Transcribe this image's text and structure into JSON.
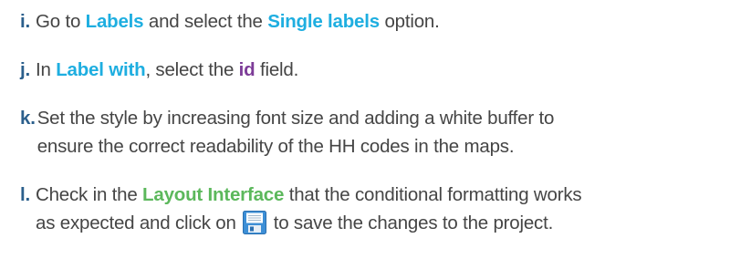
{
  "steps": [
    {
      "letter": "i.",
      "t1": "Go to ",
      "k1": "Labels",
      "t2": " and select the ",
      "k2": "Single labels",
      "t3": " option."
    },
    {
      "letter": "j.",
      "t1": "In ",
      "k1": "Label with",
      "t2": ", select the ",
      "k2": "id",
      "t3": " field."
    },
    {
      "letter": "k.",
      "line1": "Set the style by increasing font size and adding a white buffer to",
      "line2": "ensure the correct readability of the HH codes in the maps."
    },
    {
      "letter": "l.",
      "t1": "Check in the ",
      "k1": "Layout Interface",
      "t2": " that the conditional formatting works",
      "t3": "as expected and click on ",
      "icon": "save-floppy-icon",
      "t4": " to save the changes to the project."
    }
  ],
  "colors": {
    "letter": "#2b5f8c",
    "keyword_blue": "#1eaee0",
    "keyword_purple": "#7d3c98",
    "keyword_green": "#5cb85c",
    "text": "#454545"
  }
}
